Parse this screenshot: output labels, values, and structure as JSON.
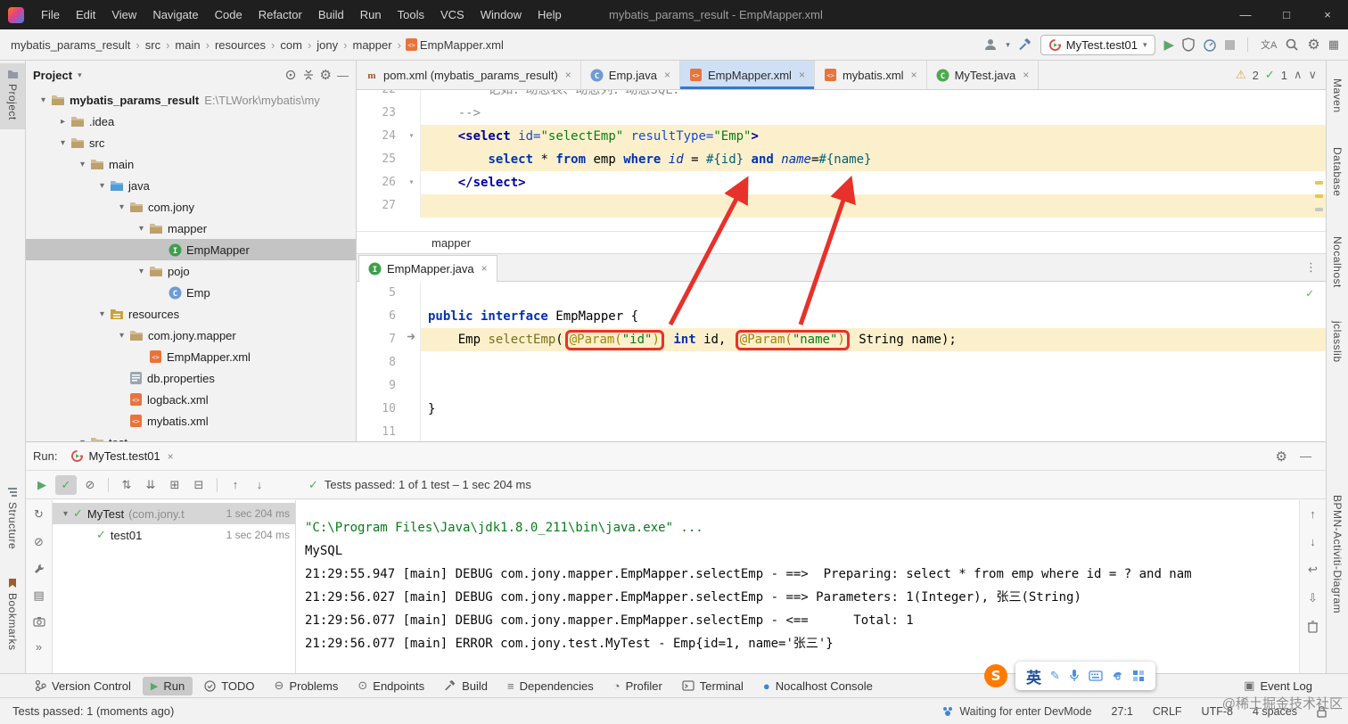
{
  "titlebar": {
    "menus": [
      "File",
      "Edit",
      "View",
      "Navigate",
      "Code",
      "Refactor",
      "Build",
      "Run",
      "Tools",
      "VCS",
      "Window",
      "Help"
    ],
    "title": "mybatis_params_result - EmpMapper.xml",
    "controls": [
      "—",
      "□",
      "×"
    ]
  },
  "navbar": {
    "breadcrumbs": [
      "mybatis_params_result",
      "src",
      "main",
      "resources",
      "com",
      "jony",
      "mapper",
      "EmpMapper.xml"
    ],
    "run_config": "MyTest.test01",
    "translate_icon": "文A"
  },
  "stripes": {
    "left_top": "Project",
    "left_bottom": [
      "Structure",
      "Bookmarks"
    ],
    "right": [
      "Maven",
      "Database",
      "Nocalhost",
      "jclasslib",
      "BPMN-Activiti-Diagram"
    ]
  },
  "project": {
    "title": "Project",
    "tree": [
      {
        "label": "mybatis_params_result",
        "path": " E:\\TLWork\\mybatis\\my",
        "icon": "folder",
        "depth": 0,
        "arrow": "v",
        "bold": true
      },
      {
        "label": ".idea",
        "icon": "folder",
        "depth": 1,
        "arrow": ">"
      },
      {
        "label": "src",
        "icon": "folder",
        "depth": 1,
        "arrow": "v"
      },
      {
        "label": "main",
        "icon": "folder",
        "depth": 2,
        "arrow": "v"
      },
      {
        "label": "java",
        "icon": "folder-src",
        "depth": 3,
        "arrow": "v"
      },
      {
        "label": "com.jony",
        "icon": "folder",
        "depth": 4,
        "arrow": "v"
      },
      {
        "label": "mapper",
        "icon": "folder",
        "depth": 5,
        "arrow": "v"
      },
      {
        "label": "EmpMapper",
        "icon": "interface",
        "depth": 6,
        "selected": true
      },
      {
        "label": "pojo",
        "icon": "folder",
        "depth": 5,
        "arrow": "v"
      },
      {
        "label": "Emp",
        "icon": "class",
        "depth": 6
      },
      {
        "label": "resources",
        "icon": "folder-res",
        "depth": 3,
        "arrow": "v"
      },
      {
        "label": "com.jony.mapper",
        "icon": "folder",
        "depth": 4,
        "arrow": "v"
      },
      {
        "label": "EmpMapper.xml",
        "icon": "xml",
        "depth": 5
      },
      {
        "label": "db.properties",
        "icon": "props",
        "depth": 4
      },
      {
        "label": "logback.xml",
        "icon": "xml",
        "depth": 4
      },
      {
        "label": "mybatis.xml",
        "icon": "xml",
        "depth": 4
      },
      {
        "label": "test",
        "icon": "folder",
        "depth": 2,
        "arrow": "v"
      }
    ]
  },
  "editor": {
    "tabs": [
      {
        "label": "pom.xml (mybatis_params_result)",
        "icon": "maven"
      },
      {
        "label": "Emp.java",
        "icon": "class"
      },
      {
        "label": "EmpMapper.xml",
        "icon": "xml",
        "active": true
      },
      {
        "label": "mybatis.xml",
        "icon": "xml"
      },
      {
        "label": "MyTest.java",
        "icon": "testclass"
      }
    ],
    "inspections": {
      "warnings": "2",
      "ok": "1"
    },
    "xml_lines": [
      {
        "num": "22",
        "cut": true,
        "tokens": [
          {
            "t": "        记如：动态表、动态列：动态SQL：",
            "c": "comment"
          }
        ]
      },
      {
        "num": "23",
        "tokens": [
          {
            "t": "    -->",
            "c": "comment"
          }
        ]
      },
      {
        "num": "24",
        "hl": true,
        "fold": "v",
        "tokens": [
          {
            "t": "    ",
            "c": "plain"
          },
          {
            "t": "<select",
            "c": "tag"
          },
          {
            "t": " ",
            "c": "plain"
          },
          {
            "t": "id=",
            "c": "attr"
          },
          {
            "t": "\"selectEmp\"",
            "c": "val"
          },
          {
            "t": " ",
            "c": "plain"
          },
          {
            "t": "resultType=",
            "c": "attr"
          },
          {
            "t": "\"Emp\"",
            "c": "val"
          },
          {
            "t": ">",
            "c": "tag"
          }
        ]
      },
      {
        "num": "25",
        "hl": true,
        "tokens": [
          {
            "t": "        ",
            "c": "plain"
          },
          {
            "t": "select",
            "c": "kw"
          },
          {
            "t": " * ",
            "c": "plain"
          },
          {
            "t": "from",
            "c": "kw"
          },
          {
            "t": " emp ",
            "c": "plain"
          },
          {
            "t": "where",
            "c": "kw"
          },
          {
            "t": " ",
            "c": "plain"
          },
          {
            "t": "id",
            "c": "ital"
          },
          {
            "t": " = ",
            "c": "plain"
          },
          {
            "t": "#{id}",
            "c": "param"
          },
          {
            "t": " ",
            "c": "plain"
          },
          {
            "t": "and",
            "c": "kw"
          },
          {
            "t": " ",
            "c": "plain"
          },
          {
            "t": "name",
            "c": "ital"
          },
          {
            "t": "=",
            "c": "plain"
          },
          {
            "t": "#{name}",
            "c": "param"
          }
        ]
      },
      {
        "num": "26",
        "fold": "v",
        "tokens": [
          {
            "t": "    ",
            "c": "plain"
          },
          {
            "t": "</select>",
            "c": "tag"
          }
        ]
      },
      {
        "num": "27",
        "hl": true,
        "tokens": []
      }
    ],
    "context_crumb": "mapper",
    "java_tab": {
      "label": "EmpMapper.java"
    },
    "java_lines": [
      {
        "num": "5",
        "tokens": []
      },
      {
        "num": "6",
        "tokens": [
          {
            "t": "public interface",
            "c": "kw"
          },
          {
            "t": " EmpMapper {",
            "c": "plain"
          }
        ]
      },
      {
        "num": "7",
        "hl": true,
        "gut_icon": true,
        "tokens": [
          {
            "t": "    Emp ",
            "c": "plain"
          },
          {
            "t": "selectEmp",
            "c": "method"
          },
          {
            "t": "(",
            "c": "plain"
          },
          {
            "box": true,
            "sub": [
              {
                "t": "@Param(",
                "c": "ann"
              },
              {
                "t": "\"id\"",
                "c": "str"
              },
              {
                "t": ")",
                "c": "ann"
              }
            ]
          },
          {
            "t": " ",
            "c": "plain"
          },
          {
            "t": "int",
            "c": "kw"
          },
          {
            "t": " id, ",
            "c": "plain"
          },
          {
            "box": true,
            "sub": [
              {
                "t": "@Param(",
                "c": "ann"
              },
              {
                "t": "\"name\"",
                "c": "str"
              },
              {
                "t": ")",
                "c": "ann"
              }
            ]
          },
          {
            "t": " String name);",
            "c": "plain"
          }
        ]
      },
      {
        "num": "8",
        "tokens": []
      },
      {
        "num": "9",
        "tokens": []
      },
      {
        "num": "10",
        "tokens": [
          {
            "t": "}",
            "c": "plain"
          }
        ]
      },
      {
        "num": "11",
        "tokens": []
      }
    ]
  },
  "run": {
    "label": "Run:",
    "tab": "MyTest.test01",
    "summary": "Tests passed: 1 of 1 test – 1 sec 204 ms",
    "tree": [
      {
        "name": "MyTest",
        "detail": "(com.jony.t",
        "time": "1 sec 204 ms",
        "selected": true,
        "arrow": "v",
        "depth": 0
      },
      {
        "name": "test01",
        "detail": "",
        "time": "1 sec 204 ms",
        "depth": 1
      }
    ],
    "console": [
      {
        "text": "\"C:\\Program Files\\Java\\jdk1.8.0_211\\bin\\java.exe\" ...",
        "color": "green"
      },
      {
        "text": "MySQL",
        "color": "plain"
      },
      {
        "text": "21:29:55.947 [main] DEBUG com.jony.mapper.EmpMapper.selectEmp - ==>  Preparing: select * from emp where id = ? and nam",
        "color": "plain"
      },
      {
        "text": "21:29:56.027 [main] DEBUG com.jony.mapper.EmpMapper.selectEmp - ==> Parameters: 1(Integer), 张三(String)",
        "color": "plain"
      },
      {
        "text": "21:29:56.077 [main] DEBUG com.jony.mapper.EmpMapper.selectEmp - <==      Total: 1",
        "color": "plain"
      },
      {
        "text": "21:29:56.077 [main] ERROR com.jony.test.MyTest - Emp{id=1, name='张三'}",
        "color": "plain"
      }
    ]
  },
  "ime": {
    "lang": "英"
  },
  "bottombar": {
    "items": [
      "Version Control",
      "Run",
      "TODO",
      "Problems",
      "Endpoints",
      "Build",
      "Dependencies",
      "Profiler",
      "Terminal",
      "Nocalhost Console"
    ],
    "active": "Run",
    "right": "Event Log"
  },
  "statusbar": {
    "left": "Tests passed: 1 (moments ago)",
    "devmode": "Waiting for enter DevMode",
    "caret": "27:1",
    "line_ending": "CRLF",
    "encoding": "UTF-8",
    "indent": "4 spaces"
  },
  "watermark": "@稀土掘金技术社区"
}
